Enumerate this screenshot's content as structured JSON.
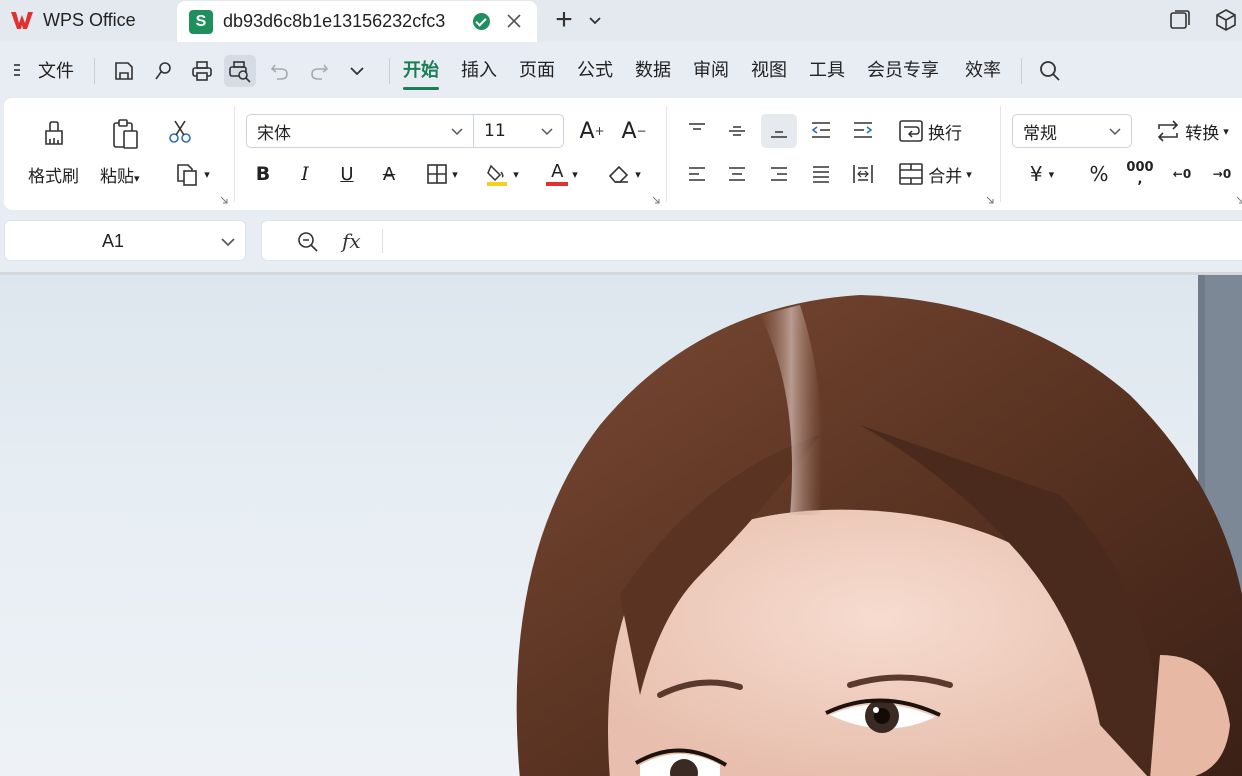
{
  "titlebar": {
    "app_name": "WPS Office",
    "document_tab": "db93d6c8b1e13156232cfc3",
    "new_tab": "+"
  },
  "menubar": {
    "file_label": "文件",
    "tabs": [
      "开始",
      "插入",
      "页面",
      "公式",
      "数据",
      "审阅",
      "视图",
      "工具",
      "会员专享",
      "效率"
    ],
    "active_tab": "开始"
  },
  "ribbon": {
    "format_painter": "格式刷",
    "paste": "粘贴",
    "font_name": "宋体",
    "font_size": "11",
    "wrap_text": "换行",
    "merge": "合并",
    "number_format": "常规",
    "convert": "转换",
    "currency_symbol": "¥",
    "percent_symbol": "%",
    "thousands_symbol": "000",
    "bold_label": "B",
    "italic_label": "I",
    "underline_label": "U",
    "strikethrough_label": "A",
    "font_color_label": "A",
    "grow_font_label": "A",
    "shrink_font_label": "A",
    "increase_decimal_label": "←0",
    "decrease_decimal_label": "→0"
  },
  "formula_bar": {
    "cell_ref": "A1",
    "fx_label": "fx",
    "formula_value": ""
  },
  "colors": {
    "accent": "#1a7f55",
    "wps_red": "#e03131",
    "sheet_green": "#1f8f5d",
    "highlight_yellow": "#f2d21c",
    "font_red": "#e03131",
    "hair": "#5a3322"
  }
}
